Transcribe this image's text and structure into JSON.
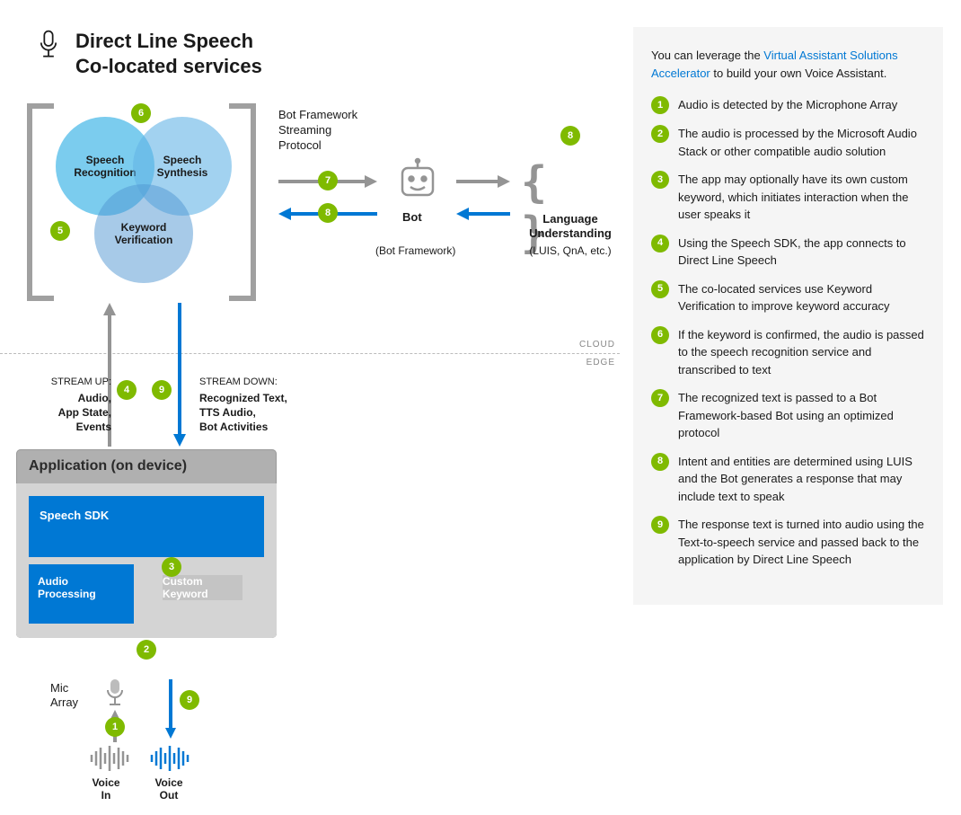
{
  "title_line1": "Direct Line Speech",
  "title_line2": "Co-located services",
  "venn": {
    "c1": "Speech Recognition",
    "c2": "Speech Synthesis",
    "c3": "Keyword Verification"
  },
  "protocol": "Bot Framework Streaming Protocol",
  "bot_label": "Bot",
  "bot_sub": "(Bot Framework)",
  "lang_label": "Language Understanding",
  "lang_sub": "(LUIS, QnA, etc.)",
  "cloud": "CLOUD",
  "edge": "EDGE",
  "stream_up_hdr": "STREAM UP:",
  "stream_up_body": "Audio, App State, Events",
  "stream_down_hdr": "STREAM DOWN:",
  "stream_down_body": "Recognized Text, TTS Audio, Bot Activities",
  "app_header": "Application (on device)",
  "sdk": "Speech SDK",
  "audio_proc": "Audio Processing",
  "custom_kw": "Custom Keyword",
  "mic_array": "Mic Array",
  "voice_in": "Voice In",
  "voice_out": "Voice Out",
  "sidebar_intro_prefix": "You can leverage the ",
  "sidebar_link": "Virtual Assistant Solutions Accelerator",
  "sidebar_intro_suffix": " to build your own Voice Assistant.",
  "steps": [
    "Audio is detected by the Microphone Array",
    "The audio is processed by the Microsoft Audio Stack or other compatible audio solution",
    "The app may optionally have its own custom keyword, which initiates interaction when the user speaks it",
    "Using the Speech SDK, the app connects to Direct Line Speech",
    "The co-located services use Keyword Verification to improve keyword accuracy",
    "If the keyword is confirmed, the audio is passed to the speech recognition service and transcribed to text",
    "The recognized text is passed to a Bot Framework-based Bot using an optimized protocol",
    "Intent and entities are determined using LUIS and the Bot generates a response that may include text to speak",
    "The response text is turned into audio using the Text-to-speech service and passed back to the application by Direct Line Speech"
  ],
  "badges": {
    "b1": "1",
    "b2": "2",
    "b3": "3",
    "b4": "4",
    "b5": "5",
    "b6": "6",
    "b7": "7",
    "b8a": "8",
    "b8b": "8",
    "b9a": "9",
    "b9b": "9"
  }
}
